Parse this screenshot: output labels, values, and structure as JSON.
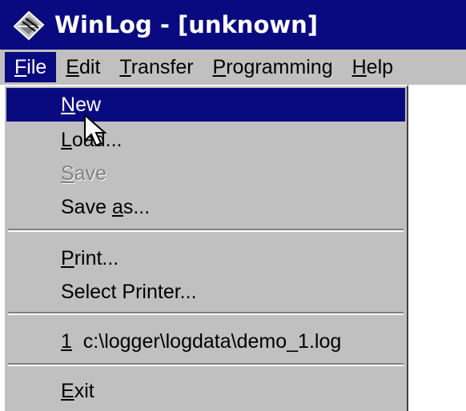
{
  "window": {
    "title": "WinLog - [unknown]",
    "icon": "winlog-app-icon"
  },
  "menubar": {
    "items": [
      {
        "mnemonic": "F",
        "rest": "ile"
      },
      {
        "mnemonic": "E",
        "rest": "dit"
      },
      {
        "mnemonic": "T",
        "rest": "ransfer"
      },
      {
        "mnemonic": "P",
        "rest": "rogramming"
      },
      {
        "mnemonic": "H",
        "rest": "elp"
      }
    ],
    "active": "File"
  },
  "file_menu": {
    "items": [
      {
        "pre": "",
        "mnemonic": "N",
        "rest": "ew",
        "state": "highlighted"
      },
      {
        "pre": "",
        "mnemonic": "L",
        "rest": "oad...",
        "state": "enabled"
      },
      {
        "pre": "",
        "mnemonic": "S",
        "rest": "ave",
        "state": "disabled"
      },
      {
        "pre": "Save ",
        "mnemonic": "a",
        "rest": "s...",
        "state": "enabled"
      },
      {
        "pre": "",
        "mnemonic": "P",
        "rest": "rint...",
        "state": "enabled"
      },
      {
        "pre": "Select Printer...",
        "mnemonic": "",
        "rest": "",
        "state": "enabled"
      },
      {
        "pre": "",
        "mnemonic": "1",
        "rest": "  c:\\logger\\logdata\\demo_1.log",
        "state": "enabled"
      },
      {
        "pre": "",
        "mnemonic": "E",
        "rest": "xit",
        "state": "enabled"
      }
    ]
  },
  "colors": {
    "titlebar": "#0a0a80",
    "menu_face": "#c0c0c0",
    "highlight": "#0a0a80",
    "disabled_text": "#808080"
  },
  "cursor": "arrow-pointer"
}
